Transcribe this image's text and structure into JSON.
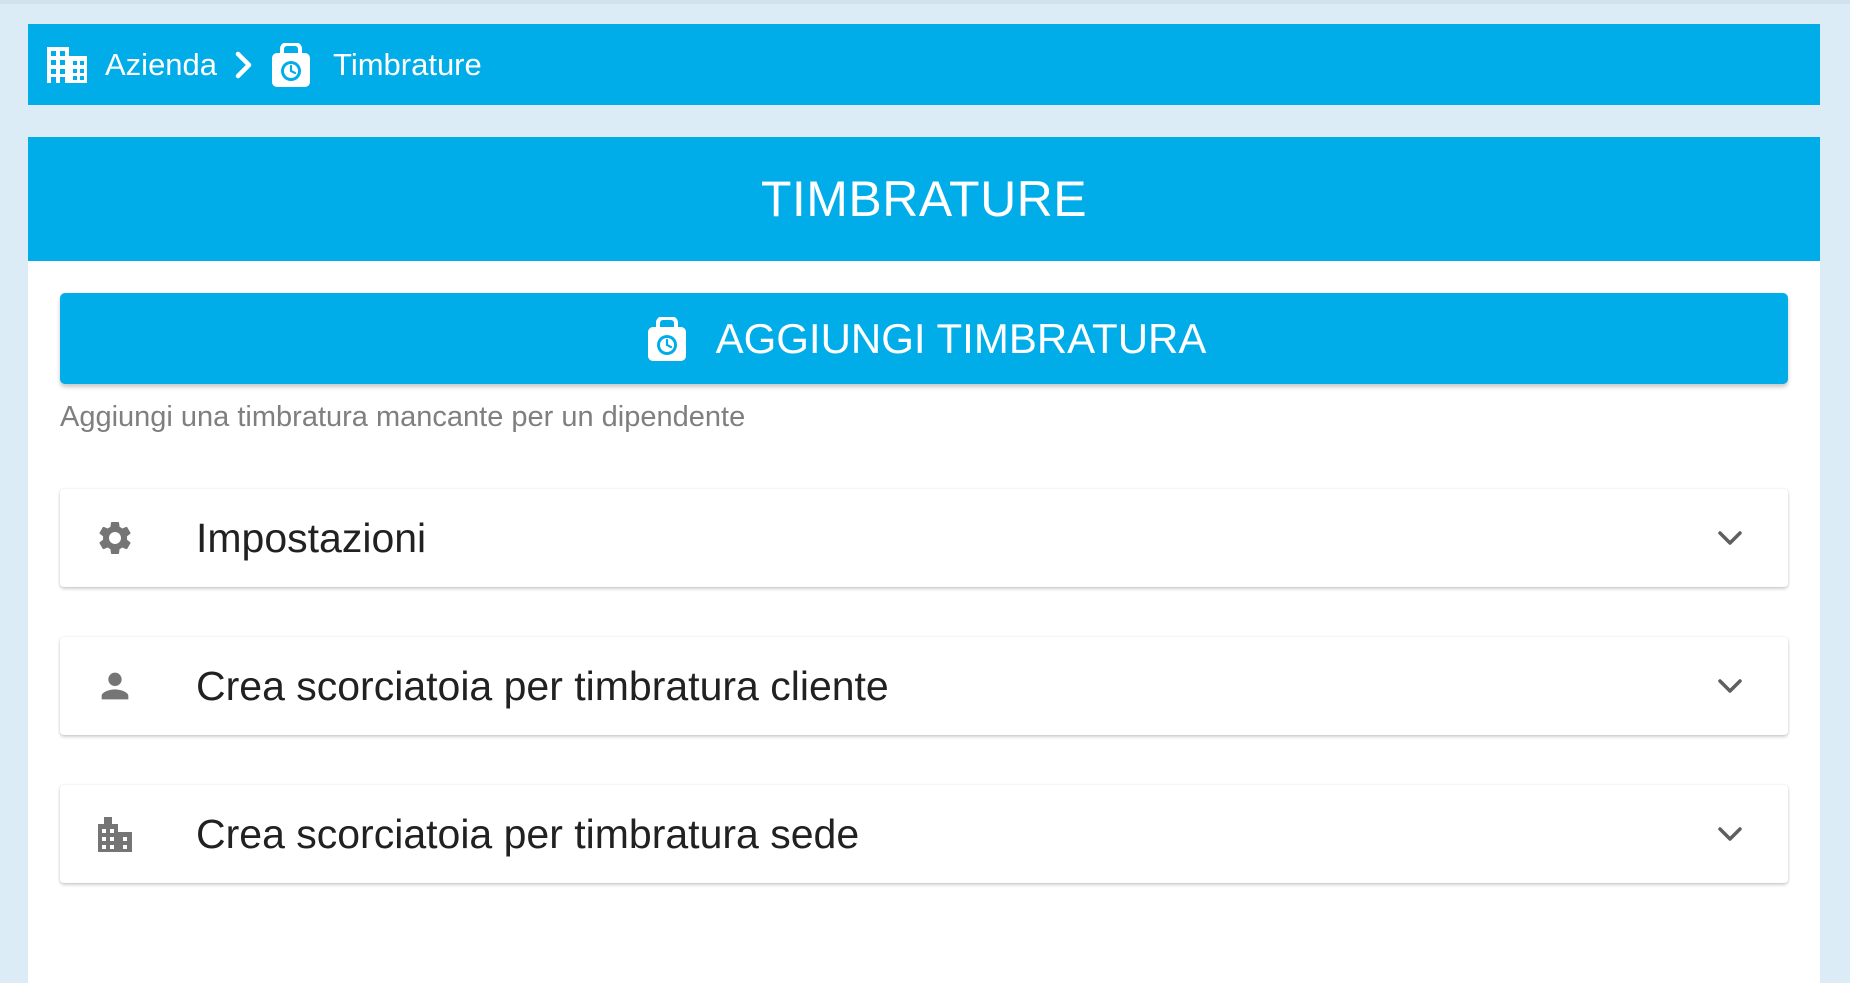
{
  "colors": {
    "primary": "#00ade9",
    "page_background": "#dbecf6",
    "card_background": "#ffffff",
    "icon_gray": "#757575",
    "hint_text": "#7f7f7f"
  },
  "breadcrumb": {
    "home": {
      "label": "Azienda",
      "icon": "business-icon"
    },
    "separator_icon": "chevron-right-icon",
    "current": {
      "label": "Timbrature",
      "icon": "timbratura-icon"
    }
  },
  "card": {
    "title": "TIMBRATURE",
    "add_button": {
      "label": "AGGIUNGI TIMBRATURA",
      "icon": "timbratura-icon"
    },
    "hint": "Aggiungi una timbratura mancante per un dipendente",
    "panels": [
      {
        "title": "Impostazioni",
        "icon": "settings-gear-icon",
        "expanded": false
      },
      {
        "title": "Crea scorciatoia per timbratura cliente",
        "icon": "person-icon",
        "expanded": false
      },
      {
        "title": "Crea scorciatoia per timbratura sede",
        "icon": "business-icon",
        "expanded": false
      }
    ]
  }
}
